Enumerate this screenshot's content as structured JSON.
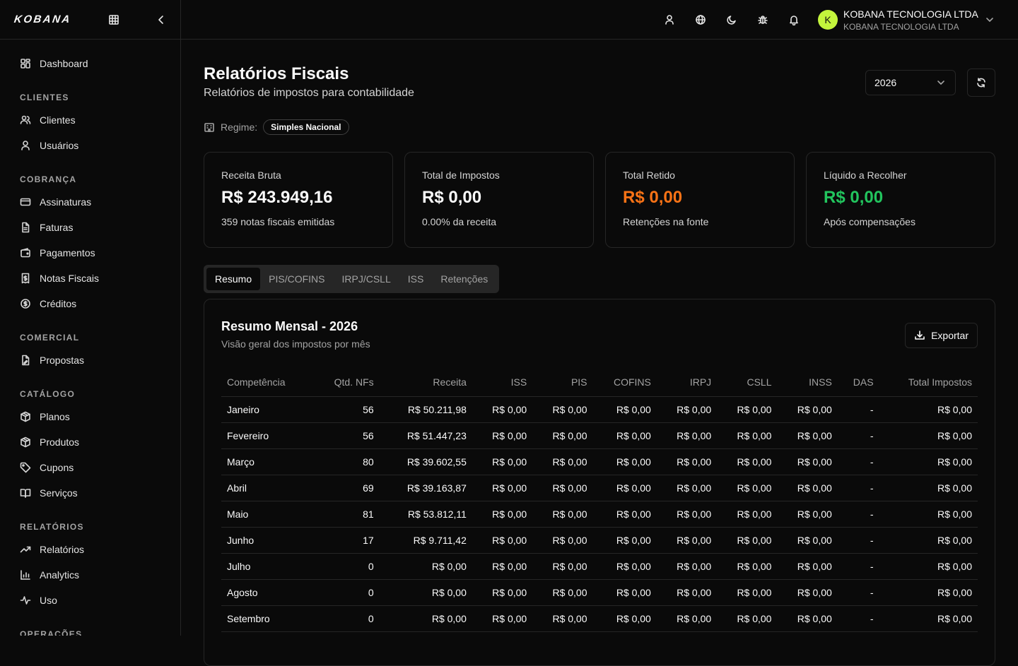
{
  "brand": {
    "logo": "KOBANA"
  },
  "sidebar": {
    "top": [
      {
        "label": "Dashboard",
        "icon": "dashboard-icon"
      }
    ],
    "sections": [
      {
        "title": "CLIENTES",
        "items": [
          {
            "label": "Clientes",
            "icon": "users-icon"
          },
          {
            "label": "Usuários",
            "icon": "user-icon"
          }
        ]
      },
      {
        "title": "COBRANÇA",
        "items": [
          {
            "label": "Assinaturas",
            "icon": "card-icon"
          },
          {
            "label": "Faturas",
            "icon": "file-icon"
          },
          {
            "label": "Pagamentos",
            "icon": "wallet-icon"
          },
          {
            "label": "Notas Fiscais",
            "icon": "receipt-icon"
          },
          {
            "label": "Créditos",
            "icon": "coin-icon"
          }
        ]
      },
      {
        "title": "COMERCIAL",
        "items": [
          {
            "label": "Propostas",
            "icon": "proposal-icon"
          }
        ]
      },
      {
        "title": "CATÁLOGO",
        "items": [
          {
            "label": "Planos",
            "icon": "box-icon"
          },
          {
            "label": "Produtos",
            "icon": "box-icon"
          },
          {
            "label": "Cupons",
            "icon": "tag-icon"
          },
          {
            "label": "Serviços",
            "icon": "book-icon"
          }
        ]
      },
      {
        "title": "RELATÓRIOS",
        "items": [
          {
            "label": "Relatórios",
            "icon": "trend-icon"
          },
          {
            "label": "Analytics",
            "icon": "bar-chart-icon"
          },
          {
            "label": "Uso",
            "icon": "activity-icon"
          }
        ]
      },
      {
        "title": "OPERAÇÕES",
        "items": []
      }
    ]
  },
  "account": {
    "initial": "K",
    "name": "KOBANA TECNOLOGIA LTDA",
    "sub": "KOBANA TECNOLOGIA LTDA"
  },
  "page": {
    "title": "Relatórios Fiscais",
    "subtitle": "Relatórios de impostos para contabilidade",
    "year": "2026",
    "regime_label": "Regime:",
    "regime_value": "Simples Nacional"
  },
  "cards": [
    {
      "label": "Receita Bruta",
      "value": "R$ 243.949,16",
      "foot": "359 notas fiscais emitidas",
      "color": "#fafafa"
    },
    {
      "label": "Total de Impostos",
      "value": "R$ 0,00",
      "foot": "0.00% da receita",
      "color": "#fafafa"
    },
    {
      "label": "Total Retido",
      "value": "R$ 0,00",
      "foot": "Retenções na fonte",
      "color": "#f97316"
    },
    {
      "label": "Líquido a Recolher",
      "value": "R$ 0,00",
      "foot": "Após compensações",
      "color": "#22c55e"
    }
  ],
  "tabs": [
    "Resumo",
    "PIS/COFINS",
    "IRPJ/CSLL",
    "ISS",
    "Retenções"
  ],
  "active_tab": "Resumo",
  "panel": {
    "title": "Resumo Mensal - 2026",
    "subtitle": "Visão geral dos impostos por mês",
    "export_label": "Exportar"
  },
  "table": {
    "columns": [
      "Competência",
      "Qtd. NFs",
      "Receita",
      "ISS",
      "PIS",
      "COFINS",
      "IRPJ",
      "CSLL",
      "INSS",
      "DAS",
      "Total Impostos"
    ],
    "rows": [
      [
        "Janeiro",
        "56",
        "R$ 50.211,98",
        "R$ 0,00",
        "R$ 0,00",
        "R$ 0,00",
        "R$ 0,00",
        "R$ 0,00",
        "R$ 0,00",
        "-",
        "R$ 0,00"
      ],
      [
        "Fevereiro",
        "56",
        "R$ 51.447,23",
        "R$ 0,00",
        "R$ 0,00",
        "R$ 0,00",
        "R$ 0,00",
        "R$ 0,00",
        "R$ 0,00",
        "-",
        "R$ 0,00"
      ],
      [
        "Março",
        "80",
        "R$ 39.602,55",
        "R$ 0,00",
        "R$ 0,00",
        "R$ 0,00",
        "R$ 0,00",
        "R$ 0,00",
        "R$ 0,00",
        "-",
        "R$ 0,00"
      ],
      [
        "Abril",
        "69",
        "R$ 39.163,87",
        "R$ 0,00",
        "R$ 0,00",
        "R$ 0,00",
        "R$ 0,00",
        "R$ 0,00",
        "R$ 0,00",
        "-",
        "R$ 0,00"
      ],
      [
        "Maio",
        "81",
        "R$ 53.812,11",
        "R$ 0,00",
        "R$ 0,00",
        "R$ 0,00",
        "R$ 0,00",
        "R$ 0,00",
        "R$ 0,00",
        "-",
        "R$ 0,00"
      ],
      [
        "Junho",
        "17",
        "R$ 9.711,42",
        "R$ 0,00",
        "R$ 0,00",
        "R$ 0,00",
        "R$ 0,00",
        "R$ 0,00",
        "R$ 0,00",
        "-",
        "R$ 0,00"
      ],
      [
        "Julho",
        "0",
        "R$ 0,00",
        "R$ 0,00",
        "R$ 0,00",
        "R$ 0,00",
        "R$ 0,00",
        "R$ 0,00",
        "R$ 0,00",
        "-",
        "R$ 0,00"
      ],
      [
        "Agosto",
        "0",
        "R$ 0,00",
        "R$ 0,00",
        "R$ 0,00",
        "R$ 0,00",
        "R$ 0,00",
        "R$ 0,00",
        "R$ 0,00",
        "-",
        "R$ 0,00"
      ],
      [
        "Setembro",
        "0",
        "R$ 0,00",
        "R$ 0,00",
        "R$ 0,00",
        "R$ 0,00",
        "R$ 0,00",
        "R$ 0,00",
        "R$ 0,00",
        "-",
        "R$ 0,00"
      ]
    ]
  }
}
